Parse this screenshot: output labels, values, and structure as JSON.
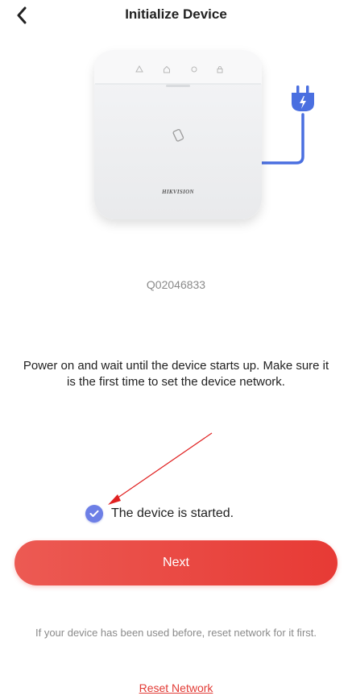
{
  "header": {
    "back_icon": "chevron-left-icon",
    "title": "Initialize Device"
  },
  "device": {
    "brand": "HIKVISION",
    "indicator_icons": [
      "alarm-icon",
      "home-icon",
      "dot-icon",
      "lock-icon"
    ],
    "center_icon": "card-icon",
    "plug_icon": "power-plug-icon",
    "cable_color": "#4a6fe0"
  },
  "serial": "Q02046833",
  "instruction": "Power on and wait until the device starts up. Make sure it is the first time to set the device network.",
  "started_check": {
    "label": "The device is started.",
    "checked": true,
    "icon": "check-circle-icon",
    "color": "#6d7fe6"
  },
  "next_button": {
    "label": "Next",
    "color": "#e8453f"
  },
  "reset": {
    "note": "If your device has been used before, reset network for it first.",
    "link_label": "Reset Network",
    "link_color": "#e23b35"
  },
  "annotation": {
    "type": "arrow",
    "color": "#e02020"
  }
}
